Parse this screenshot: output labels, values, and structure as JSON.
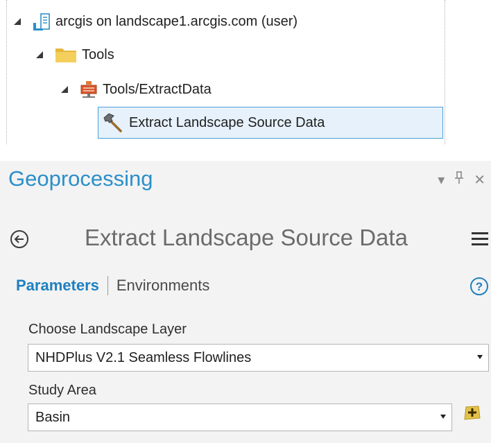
{
  "tree": {
    "server": {
      "label": "arcgis on landscape1.arcgis.com (user)",
      "icon": "server-connection-icon"
    },
    "folder": {
      "label": "Tools",
      "icon": "folder-icon"
    },
    "service": {
      "label": "Tools/ExtractData",
      "icon": "geoprocessing-service-icon"
    },
    "tool": {
      "label": "Extract Landscape Source Data",
      "icon": "hammer-tool-icon",
      "selected": true
    }
  },
  "pane": {
    "title": "Geoprocessing",
    "controls": {
      "dropdown": "▾",
      "pin": "⊥",
      "close": "✕"
    },
    "tool_title": "Extract Landscape Source Data",
    "tabs": {
      "active": "Parameters",
      "other": "Environments"
    },
    "params": [
      {
        "label": "Choose Landscape Layer",
        "value": "NHDPlus V2.1 Seamless Flowlines"
      },
      {
        "label": "Study Area",
        "value": "Basin"
      }
    ]
  },
  "colors": {
    "accent": "#1e80c1",
    "title": "#2b8fc9",
    "selection": "#e6f1fb",
    "selection_border": "#4d9fd9"
  }
}
